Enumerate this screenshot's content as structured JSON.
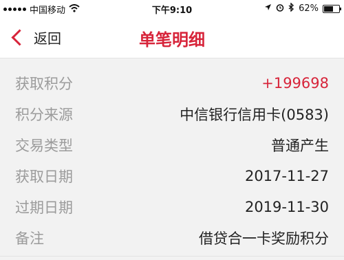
{
  "status_bar": {
    "carrier": "中国移动",
    "time": "下午9:10",
    "battery_percent": "62%",
    "battery_level": 0.62
  },
  "nav": {
    "back_label": "返回",
    "title": "单笔明细"
  },
  "details": [
    {
      "label": "获取积分",
      "value": "+199698"
    },
    {
      "label": "积分来源",
      "value": "中信银行信用卡(0583)"
    },
    {
      "label": "交易类型",
      "value": "普通产生"
    },
    {
      "label": "获取日期",
      "value": "2017-11-27"
    },
    {
      "label": "过期日期",
      "value": "2019-11-30"
    },
    {
      "label": "备注",
      "value": "借贷合一卡奖励积分"
    }
  ],
  "colors": {
    "accent": "#d7243a",
    "label": "#9b9b9b",
    "background": "#f2f2f2"
  },
  "icons": [
    "signal-icon",
    "wifi-icon",
    "location-icon",
    "alarm-icon",
    "bluetooth-icon",
    "battery-icon",
    "back-chevron-icon"
  ]
}
